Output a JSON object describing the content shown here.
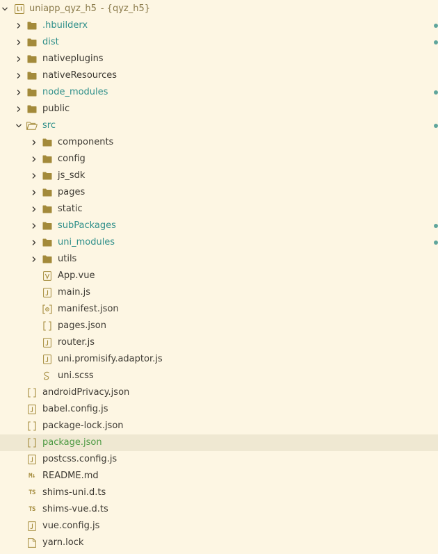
{
  "colors": {
    "background": "#fdf6e3",
    "text": "#3d3a33",
    "modified": "#2f8f8a",
    "modified_dot": "#5fa59c",
    "selected_row": "#efe8d2",
    "selected_text": "#4d9a43",
    "icon": "#a38a3a",
    "project_title": "#8a7a4a"
  },
  "project": {
    "name": "uniapp_qyz_h5",
    "suffix": "- {qyz_h5}"
  },
  "tree": [
    {
      "label": ".hbuilderx",
      "type": "folder",
      "depth": 1,
      "expanded": false,
      "modified": true
    },
    {
      "label": "dist",
      "type": "folder",
      "depth": 1,
      "expanded": false,
      "modified": true
    },
    {
      "label": "nativeplugins",
      "type": "folder",
      "depth": 1,
      "expanded": false,
      "modified": false
    },
    {
      "label": "nativeResources",
      "type": "folder",
      "depth": 1,
      "expanded": false,
      "modified": false
    },
    {
      "label": "node_modules",
      "type": "folder",
      "depth": 1,
      "expanded": false,
      "modified": true
    },
    {
      "label": "public",
      "type": "folder",
      "depth": 1,
      "expanded": false,
      "modified": false
    },
    {
      "label": "src",
      "type": "folder-open",
      "depth": 1,
      "expanded": true,
      "modified": true
    },
    {
      "label": "components",
      "type": "folder",
      "depth": 2,
      "expanded": false,
      "modified": false
    },
    {
      "label": "config",
      "type": "folder",
      "depth": 2,
      "expanded": false,
      "modified": false
    },
    {
      "label": "js_sdk",
      "type": "folder",
      "depth": 2,
      "expanded": false,
      "modified": false
    },
    {
      "label": "pages",
      "type": "folder",
      "depth": 2,
      "expanded": false,
      "modified": false
    },
    {
      "label": "static",
      "type": "folder",
      "depth": 2,
      "expanded": false,
      "modified": false
    },
    {
      "label": "subPackages",
      "type": "folder",
      "depth": 2,
      "expanded": false,
      "modified": true
    },
    {
      "label": "uni_modules",
      "type": "folder",
      "depth": 2,
      "expanded": false,
      "modified": true
    },
    {
      "label": "utils",
      "type": "folder",
      "depth": 2,
      "expanded": false,
      "modified": false
    },
    {
      "label": "App.vue",
      "type": "vue",
      "depth": 2,
      "modified": false
    },
    {
      "label": "main.js",
      "type": "js",
      "depth": 2,
      "modified": false
    },
    {
      "label": "manifest.json",
      "type": "manifest",
      "depth": 2,
      "modified": false
    },
    {
      "label": "pages.json",
      "type": "json",
      "depth": 2,
      "modified": false
    },
    {
      "label": "router.js",
      "type": "js",
      "depth": 2,
      "modified": false
    },
    {
      "label": "uni.promisify.adaptor.js",
      "type": "js",
      "depth": 2,
      "modified": false
    },
    {
      "label": "uni.scss",
      "type": "scss",
      "depth": 2,
      "modified": false
    },
    {
      "label": "androidPrivacy.json",
      "type": "json",
      "depth": 1,
      "modified": false
    },
    {
      "label": "babel.config.js",
      "type": "js",
      "depth": 1,
      "modified": false
    },
    {
      "label": "package-lock.json",
      "type": "json",
      "depth": 1,
      "modified": false
    },
    {
      "label": "package.json",
      "type": "json",
      "depth": 1,
      "modified": false,
      "selected": true
    },
    {
      "label": "postcss.config.js",
      "type": "js",
      "depth": 1,
      "modified": false
    },
    {
      "label": "README.md",
      "type": "md",
      "depth": 1,
      "modified": false
    },
    {
      "label": "shims-uni.d.ts",
      "type": "ts",
      "depth": 1,
      "modified": false
    },
    {
      "label": "shims-vue.d.ts",
      "type": "ts",
      "depth": 1,
      "modified": false
    },
    {
      "label": "vue.config.js",
      "type": "js",
      "depth": 1,
      "modified": false
    },
    {
      "label": "yarn.lock",
      "type": "file",
      "depth": 1,
      "modified": false
    }
  ]
}
